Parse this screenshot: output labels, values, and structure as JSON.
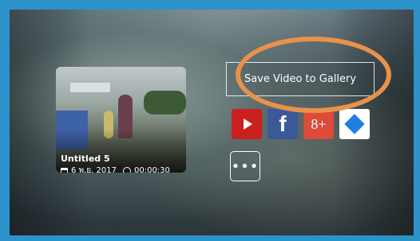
{
  "video": {
    "title": "Untitled 5",
    "date": "6 พ.ย. 2017",
    "duration": "00:00:30"
  },
  "actions": {
    "save_label": "Save Video to Gallery",
    "more_label": "•••",
    "share": [
      {
        "name": "youtube-icon",
        "label": "YouTube"
      },
      {
        "name": "facebook-icon",
        "label": "f"
      },
      {
        "name": "google-plus-icon",
        "label": "8+"
      },
      {
        "name": "dropbox-icon",
        "label": "Dropbox"
      }
    ]
  },
  "colors": {
    "frame": "#2b93c9",
    "highlight": "#e9914a",
    "youtube": "#cc1f1f",
    "facebook": "#3b5998",
    "googleplus": "#dd4b39",
    "dropbox": "#1e7fe0"
  }
}
